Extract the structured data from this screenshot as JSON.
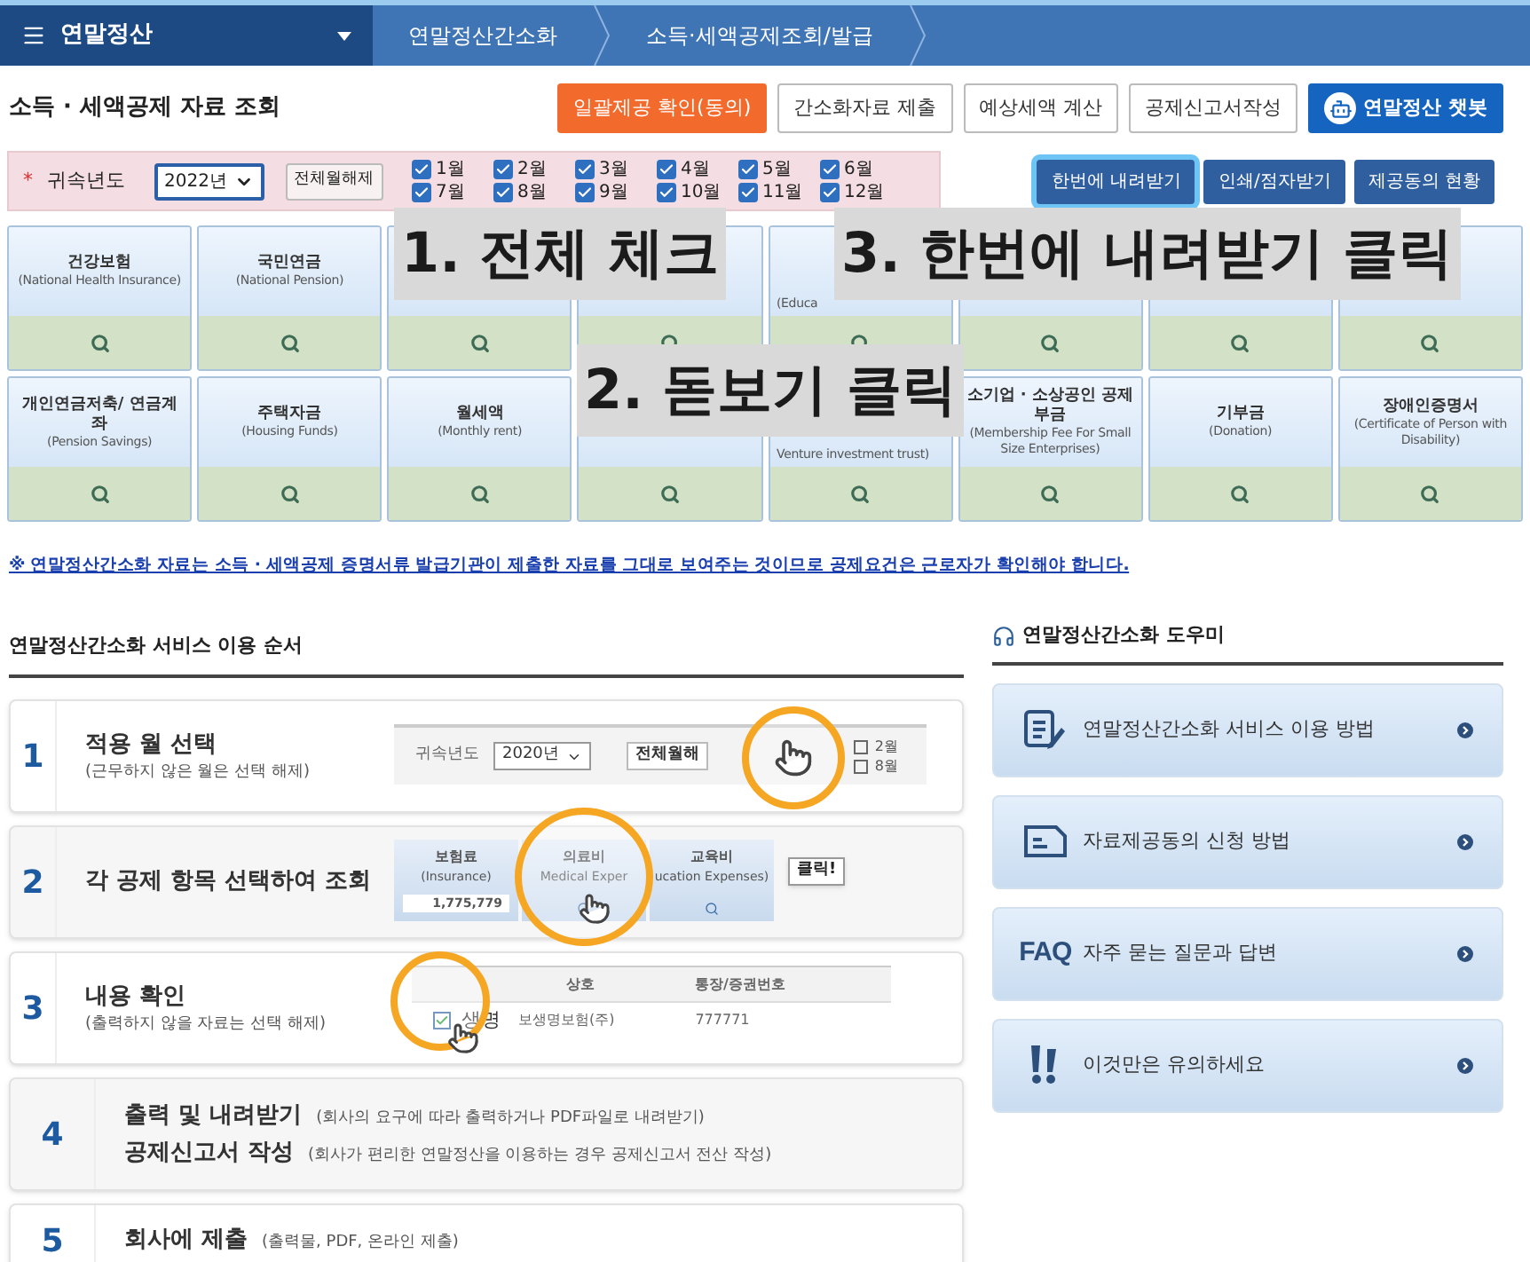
{
  "nav": {
    "menu": "연말정산",
    "crumbs": [
      "연말정산간소화",
      "소득·세액공제조회/발급"
    ]
  },
  "title": "소득 · 세액공제 자료 조회",
  "top_buttons": [
    {
      "label": "일괄제공 확인(동의)",
      "kind": "orange"
    },
    {
      "label": "간소화자료 제출",
      "kind": "plain"
    },
    {
      "label": "예상세액 계산",
      "kind": "plain"
    },
    {
      "label": "공제신고서작성",
      "kind": "plain"
    },
    {
      "label": "연말정산 챗봇",
      "kind": "blue"
    }
  ],
  "filter": {
    "mark": "*",
    "label": "귀속년도",
    "year": "2022년",
    "clear_button": "전체월해제",
    "months": [
      {
        "label": "1월",
        "checked": true
      },
      {
        "label": "2월",
        "checked": true
      },
      {
        "label": "3월",
        "checked": true
      },
      {
        "label": "4월",
        "checked": true
      },
      {
        "label": "5월",
        "checked": true
      },
      {
        "label": "6월",
        "checked": true
      },
      {
        "label": "7월",
        "checked": true
      },
      {
        "label": "8월",
        "checked": true
      },
      {
        "label": "9월",
        "checked": true
      },
      {
        "label": "10월",
        "checked": true
      },
      {
        "label": "11월",
        "checked": true
      },
      {
        "label": "12월",
        "checked": true
      }
    ],
    "actions": [
      {
        "label": "한번에 내려받기",
        "highlighted": true
      },
      {
        "label": "인쇄/점자받기",
        "highlighted": false
      },
      {
        "label": "제공동의 현황",
        "highlighted": false
      }
    ]
  },
  "tiles": [
    {
      "kind": "full",
      "title": "건강보험",
      "sub": "(National Health Insurance)"
    },
    {
      "kind": "full",
      "title": "국민연금",
      "sub": "(National Pension)"
    },
    {
      "kind": "covered"
    },
    {
      "kind": "covered"
    },
    {
      "kind": "partial",
      "sub": "(Educa"
    },
    {
      "kind": "covered"
    },
    {
      "kind": "covered"
    },
    {
      "kind": "covered"
    },
    {
      "kind": "full",
      "title": "개인연금저축/ 연금계좌",
      "sub": "(Pension Savings)"
    },
    {
      "kind": "full",
      "title": "주택자금",
      "sub": "(Housing Funds)"
    },
    {
      "kind": "full",
      "title": "월세액",
      "sub": "(Monthly rent)"
    },
    {
      "kind": "covered"
    },
    {
      "kind": "partial",
      "sub": "Venture investment trust)"
    },
    {
      "kind": "full",
      "title": "소기업 · 소상공인 공제부금",
      "sub": "(Membership Fee For Small Size Enterprises)"
    },
    {
      "kind": "full",
      "title": "기부금",
      "sub": "(Donation)"
    },
    {
      "kind": "full",
      "title": "장애인증명서",
      "sub": "(Certificate of Person with Disability)"
    }
  ],
  "notice": "※ 연말정산간소화 자료는 소득 · 세액공제 증명서류 발급기관이 제출한 자료를 그대로 보여주는 것이므로 공제요건은 근로자가 확인해야 합니다.",
  "steps_heading": "연말정산간소화 서비스 이용 순서",
  "steps": [
    {
      "number": "1",
      "kind": "stacked",
      "lines": [
        {
          "title": "적용 월 선택",
          "note": "(근무하지 않은 월은 선택 해제)"
        }
      ],
      "illustration": {
        "kind": "months",
        "label": "귀속년도",
        "year": "2020년",
        "button": "전체월해",
        "checks": [
          "2월",
          "8월"
        ]
      }
    },
    {
      "number": "2",
      "kind": "stacked",
      "lines": [
        {
          "title": "각 공제 항목 선택하여 조회"
        }
      ],
      "illustration": {
        "kind": "tiles",
        "callout": "클릭!",
        "tiles": [
          {
            "title": "보험료",
            "sub": "(Insurance)",
            "amount": "1,775,779"
          },
          {
            "title": "의료비",
            "sub": "Medical Exper"
          },
          {
            "title": "교육비",
            "sub": "ucation Expenses)"
          }
        ]
      }
    },
    {
      "number": "3",
      "kind": "stacked",
      "lines": [
        {
          "title": "내용 확인",
          "note": "(출력하지 않을 자료는 선택 해제)"
        }
      ],
      "illustration": {
        "kind": "table",
        "checked": true,
        "columns": [
          "상호",
          "통장/증권번호"
        ],
        "cells": [
          "생명",
          "보생명보험(주)",
          "777771"
        ]
      }
    },
    {
      "number": "4",
      "kind": "inline",
      "lines": [
        {
          "title": "출력 및 내려받기",
          "note": "(회사의 요구에 따라 출력하거나 PDF파일로 내려받기)"
        },
        {
          "title": "공제신고서 작성",
          "note": "(회사가 편리한 연말정산을 이용하는 경우 공제신고서 전산 작성)"
        }
      ]
    },
    {
      "number": "5",
      "kind": "inline",
      "lines": [
        {
          "title": "회사에 제출",
          "note": "(출력물, PDF, 온라인 제출)"
        }
      ]
    }
  ],
  "helper_heading": "연말정산간소화 도우미",
  "helpers": [
    {
      "kind": "doc-pen",
      "label": "연말정산간소화 서비스 이용 방법"
    },
    {
      "kind": "doc",
      "label": "자료제공동의 신청 방법"
    },
    {
      "kind": "faq",
      "badge": "FAQ",
      "label": "자주 묻는 질문과 답변"
    },
    {
      "kind": "alert",
      "label": "이것만은 유의하세요"
    }
  ],
  "annotations": [
    "1. 전체 체크",
    "2. 돋보기 클릭",
    "3. 한번에 내려받기 클릭"
  ]
}
